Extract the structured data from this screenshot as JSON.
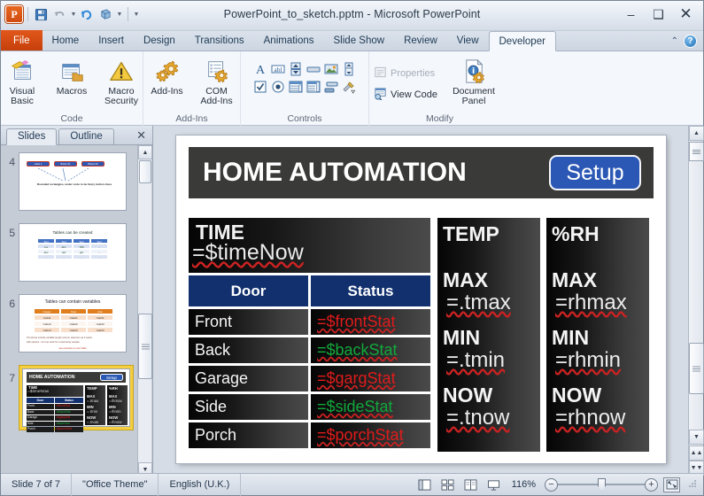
{
  "window": {
    "title": "PowerPoint_to_sketch.pptm  -  Microsoft PowerPoint",
    "minimize": "–",
    "maximize": "❑",
    "close": "✕"
  },
  "quick_access": {
    "app_letter": "P",
    "items": [
      {
        "name": "save-icon",
        "label": "Save"
      },
      {
        "name": "undo-icon",
        "label": "Undo"
      },
      {
        "name": "redo-icon",
        "label": "Redo"
      },
      {
        "name": "repeat-icon",
        "label": "Repeat"
      },
      {
        "name": "customize-qat-icon",
        "label": "Customize Quick Access Toolbar"
      }
    ]
  },
  "tabs": {
    "file": "File",
    "items": [
      "Home",
      "Insert",
      "Design",
      "Transitions",
      "Animations",
      "Slide Show",
      "Review",
      "View",
      "Developer"
    ],
    "active": "Developer",
    "help": "?",
    "minimize_ribbon": "⌃"
  },
  "ribbon": {
    "groups": [
      {
        "label": "Code",
        "buttons": [
          {
            "name": "visual-basic-button",
            "label": "Visual\nBasic",
            "line1": "Visual",
            "line2": "Basic"
          },
          {
            "name": "macros-button",
            "label": "Macros",
            "line1": "Macros",
            "line2": ""
          },
          {
            "name": "macro-security-button",
            "label": "Macro Security",
            "line1": "Macro",
            "line2": "Security"
          }
        ]
      },
      {
        "label": "Add-Ins",
        "buttons": [
          {
            "name": "add-ins-button",
            "label": "Add-Ins",
            "line1": "Add-Ins",
            "line2": ""
          },
          {
            "name": "com-add-ins-button",
            "label": "COM Add-Ins",
            "line1": "COM",
            "line2": "Add-Ins"
          }
        ]
      },
      {
        "label": "Controls",
        "row1": [
          "label-control-icon",
          "textbox-control-icon",
          "spinbutton-control-icon",
          "commandbutton-control-icon",
          "image-control-icon",
          "scrollbar-control-icon"
        ],
        "row2": [
          "checkbox-control-icon",
          "optionbutton-control-icon",
          "combobox-control-icon",
          "listbox-control-icon",
          "togglebutton-control-icon",
          "more-controls-icon"
        ]
      },
      {
        "label": "Modify",
        "properties": "Properties",
        "view_code": "View Code",
        "document_panel_line1": "Document",
        "document_panel_line2": "Panel"
      }
    ]
  },
  "slides_pane": {
    "tabs": [
      {
        "name": "slides-tab",
        "label": "Slides",
        "active": true
      },
      {
        "name": "outline-tab",
        "label": "Outline",
        "active": false
      }
    ],
    "close": "✕",
    "thumbnails": [
      {
        "number": "4",
        "type": "buttons",
        "buttons": [
          "Label 1",
          "Button #1",
          "Button #2"
        ],
        "caption": "Rounded rectangles, under code to be fancy button class"
      },
      {
        "number": "5",
        "type": "table",
        "title": "Tables can be created",
        "headers": [
          "Text",
          "Text",
          "Text",
          "Text"
        ],
        "rows": [
          [
            "xxx",
            "abc",
            "789",
            "..."
          ],
          [
            "abc",
            "def",
            "ghi",
            "..."
          ],
          [
            "...",
            "...",
            "...",
            "..."
          ]
        ]
      },
      {
        "number": "6",
        "type": "table-vars",
        "title": "Tables can contain variables",
        "headers": [
          "integer",
          "float",
          "char"
        ],
        "rows": [
          [
            "=tab11",
            "=tab21",
            "=tab31"
          ],
          [
            "=tab12",
            "=tab22",
            "=tab32"
          ],
          [
            "=tab13",
            "=tab23",
            "=tab33"
          ]
        ],
        "note1": "The Rows include variable length column selectors as it works",
        "note2": "with options - for true work for a dual array sample",
        "note3": "see example on next slide"
      },
      {
        "number": "7",
        "type": "home-automation",
        "selected": true
      }
    ]
  },
  "slide": {
    "title": "HOME AUTOMATION",
    "setup_button": "Setup",
    "time": {
      "label": "TIME",
      "variable": "=$timeNow"
    },
    "table": {
      "headers": [
        "Door",
        "Status"
      ],
      "rows": [
        {
          "door": "Front",
          "status": "=$frontStat",
          "color": "red"
        },
        {
          "door": "Back",
          "status": "=$backStat",
          "color": "green"
        },
        {
          "door": "Garage",
          "status": "=$gargStat",
          "color": "red"
        },
        {
          "door": "Side",
          "status": "=$sideStat",
          "color": "green"
        },
        {
          "door": "Porch",
          "status": "=$porchStat",
          "color": "red"
        }
      ]
    },
    "temp": {
      "title": "TEMP",
      "metrics": [
        {
          "label": "MAX",
          "value": "=.tmax"
        },
        {
          "label": "MIN",
          "value": "=.tmin"
        },
        {
          "label": "NOW",
          "value": "=.tnow"
        }
      ]
    },
    "rh": {
      "title": "%RH",
      "metrics": [
        {
          "label": "MAX",
          "value": "=rhmax"
        },
        {
          "label": "MIN",
          "value": "=rhmin"
        },
        {
          "label": "NOW",
          "value": "=rhnow"
        }
      ]
    },
    "colors": {
      "header_bg": "#3a3a38",
      "setup_bg": "#2b57b5",
      "table_header_bg": "#12306e",
      "status_red": "#e01b1b",
      "status_green": "#13a83c"
    }
  },
  "status_bar": {
    "slide_count": "Slide 7 of 7",
    "theme": "\"Office Theme\"",
    "language": "English (U.K.)",
    "zoom": "116%",
    "views": [
      "normal-view-icon",
      "slide-sorter-icon",
      "reading-view-icon",
      "slide-show-icon"
    ],
    "zoom_out": "−",
    "zoom_in": "+",
    "fit_label": "fit-slide-to-window-icon"
  }
}
